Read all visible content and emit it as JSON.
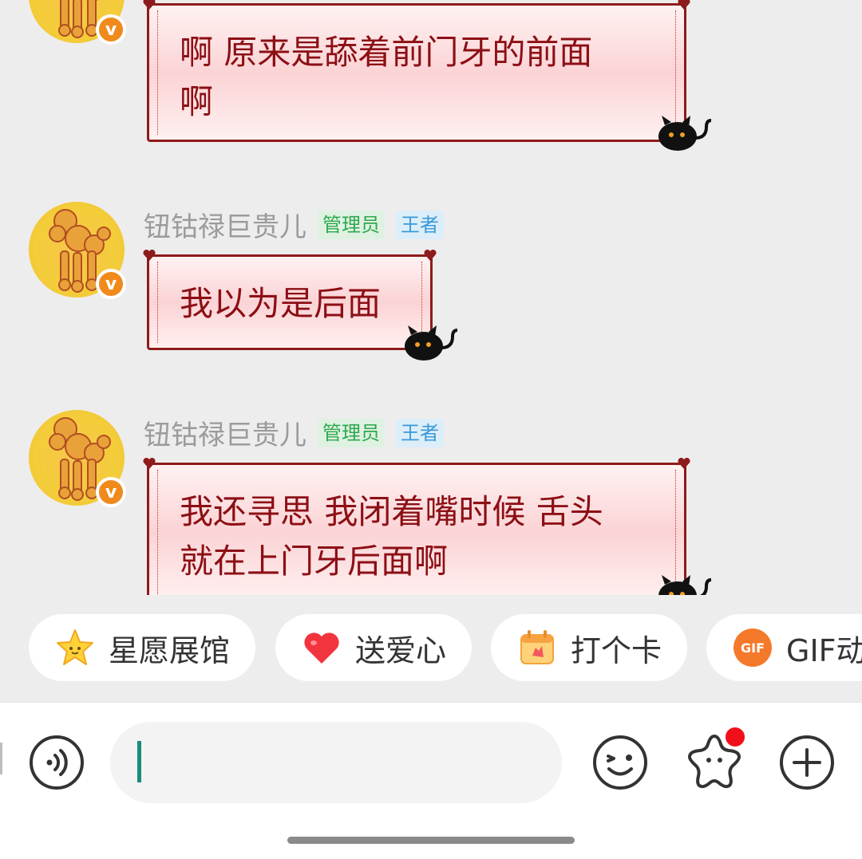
{
  "messages": [
    {
      "id": "m1",
      "sender": "",
      "text_lines": [
        "啊 原来是舔着前门牙的前面",
        "啊"
      ]
    },
    {
      "id": "m2",
      "sender": "钮钴禄巨贵儿",
      "badges": {
        "admin": "管理员",
        "rank": "王者"
      },
      "text_lines": [
        "我以为是后面"
      ]
    },
    {
      "id": "m3",
      "sender": "钮钴禄巨贵儿",
      "badges": {
        "admin": "管理员",
        "rank": "王者"
      },
      "text_lines": [
        "我还寻思 我闭着嘴时候 舌头",
        "就在上门牙后面啊"
      ]
    }
  ],
  "verified_badge": "v",
  "quick_actions": [
    {
      "label": "星愿展馆",
      "icon": "star-icon"
    },
    {
      "label": "送爱心",
      "icon": "heart-icon"
    },
    {
      "label": "打个卡",
      "icon": "calendar-checkin-icon"
    },
    {
      "label": "GIF动",
      "icon": "gif-icon",
      "icon_text": "GIF"
    }
  ],
  "input": {
    "value": "",
    "placeholder": ""
  },
  "colors": {
    "bubble_text": "#8c0f15",
    "bubble_border": "#8e1b1b",
    "admin_tag": "#2ea84e",
    "rank_tag": "#3a9ad9",
    "caret": "#1a8c7a",
    "notification_dot": "#f1101a"
  }
}
